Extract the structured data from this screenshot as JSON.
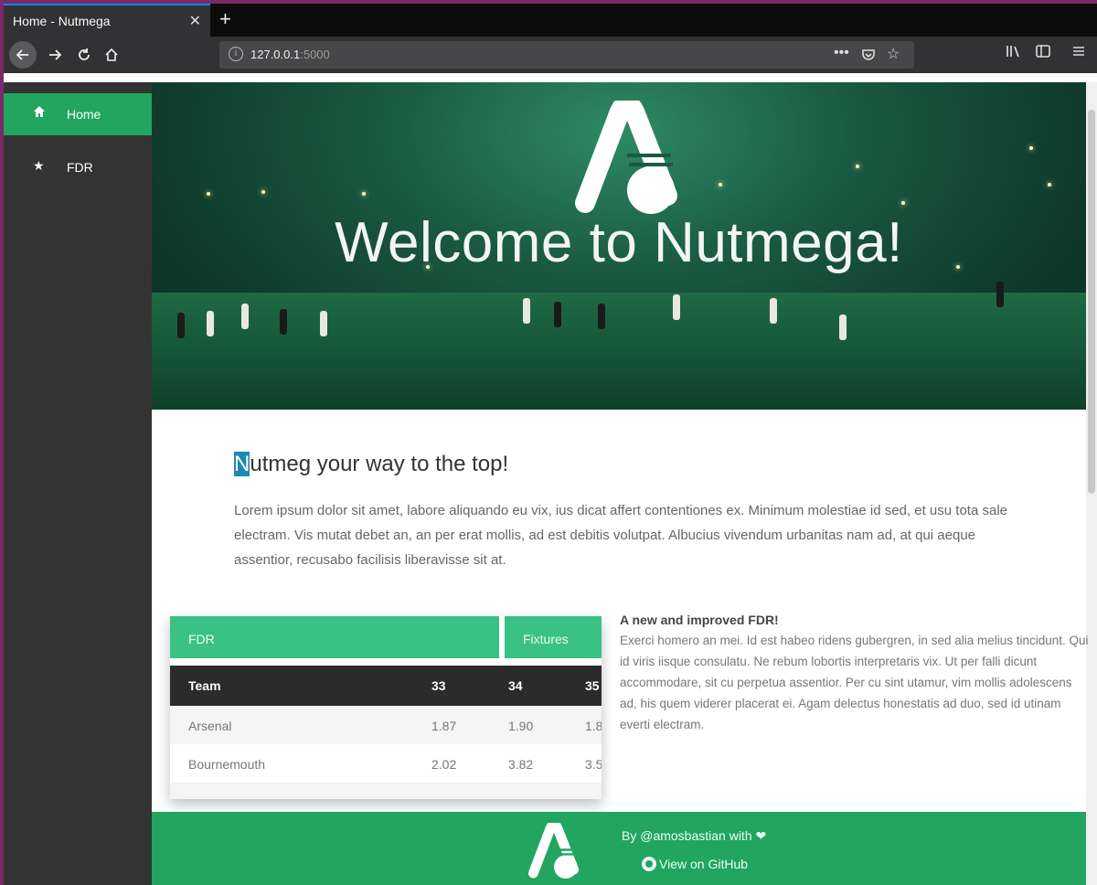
{
  "browser": {
    "tab_title": "Home - Nutmega",
    "tab_close": "✕",
    "new_tab": "+",
    "url_host": "127.0.0.1",
    "url_port": ":5000"
  },
  "sidebar": {
    "items": [
      {
        "label": "Home",
        "icon": "home-icon",
        "active": true
      },
      {
        "label": "FDR",
        "icon": "star-icon",
        "active": false
      }
    ]
  },
  "hero": {
    "title": "Welcome to Nutmega!"
  },
  "intro": {
    "headline_first": "N",
    "headline_rest": "utmeg your way to the top!",
    "body": "Lorem ipsum dolor sit amet, labore aliquando eu vix, ius dicat affert contentiones ex. Minimum molestiae id sed, et usu tota sale electram. Vis mutat debet an, an per erat mollis, ad est debitis volutpat. Albucius vivendum urbanitas nam ad, at qui aeque assentior, recusabo facilisis liberavisse sit at."
  },
  "fdr_card": {
    "tab_fdr": "FDR",
    "tab_fixtures": "Fixtures",
    "columns": [
      "Team",
      "33",
      "34",
      "35"
    ],
    "rows": [
      {
        "team": "Arsenal",
        "v33": "1.87",
        "v34": "1.90",
        "v35": "1.8"
      },
      {
        "team": "Bournemouth",
        "v33": "2.02",
        "v34": "3.82",
        "v35": "3.5"
      }
    ]
  },
  "fdr_info": {
    "title": "A new and improved FDR!",
    "body": "Exerci homero an mei. Id est habeo ridens gubergren, in sed alia melius tincidunt. Qui id viris iisque consulatu. Ne rebum lobortis interpretaris vix. Ut per falli dicunt accommodare, sit cu perpetua assentior. Per cu sint utamur, vim mollis adolescens ad, his quem viderer placerat ei. Agam delectus honestatis ad duo, sed id utinam everti electram."
  },
  "footer": {
    "by": "By @amosbastian with ❤",
    "github": "View on GitHub"
  },
  "colors": {
    "accent": "#22a55f",
    "accent_light": "#3ac184",
    "sidebar_bg": "#333333"
  }
}
